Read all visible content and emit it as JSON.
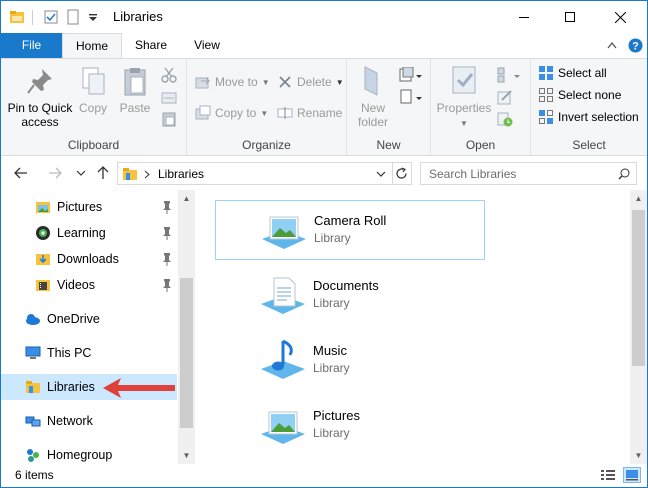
{
  "window": {
    "title": "Libraries",
    "controls": {
      "minimize": "—",
      "maximize": "☐",
      "close": "✕"
    }
  },
  "tabs": [
    {
      "label": "File"
    },
    {
      "label": "Home"
    },
    {
      "label": "Share"
    },
    {
      "label": "View"
    }
  ],
  "ribbon": {
    "clipboard": {
      "label": "Clipboard",
      "pin_line1": "Pin to Quick",
      "pin_line2": "access",
      "copy": "Copy",
      "paste": "Paste"
    },
    "organize": {
      "label": "Organize",
      "move_to": "Move to",
      "copy_to": "Copy to",
      "delete": "Delete",
      "rename": "Rename"
    },
    "new": {
      "label": "New",
      "new_line1": "New",
      "new_line2": "folder"
    },
    "open": {
      "label": "Open",
      "properties": "Properties"
    },
    "select": {
      "label": "Select",
      "select_all": "Select all",
      "select_none": "Select none",
      "invert": "Invert selection"
    }
  },
  "address": {
    "path": "Libraries",
    "search_placeholder": "Search Libraries"
  },
  "nav": {
    "items": [
      {
        "label": "Pictures",
        "icon": "pictures-icon",
        "pinned": true
      },
      {
        "label": "Learning",
        "icon": "learning-icon",
        "pinned": true
      },
      {
        "label": "Downloads",
        "icon": "downloads-icon",
        "pinned": true
      },
      {
        "label": "Videos",
        "icon": "videos-icon",
        "pinned": true
      },
      {
        "label": "OneDrive",
        "icon": "onedrive-icon"
      },
      {
        "label": "This PC",
        "icon": "this-pc-icon"
      },
      {
        "label": "Libraries",
        "icon": "libraries-icon",
        "selected": true
      },
      {
        "label": "Network",
        "icon": "network-icon"
      },
      {
        "label": "Homegroup",
        "icon": "homegroup-icon"
      }
    ]
  },
  "content": {
    "items": [
      {
        "name": "Camera Roll",
        "type": "Library",
        "icon": "camera-roll-library-icon",
        "selected": true
      },
      {
        "name": "Documents",
        "type": "Library",
        "icon": "documents-library-icon"
      },
      {
        "name": "Music",
        "type": "Library",
        "icon": "music-library-icon"
      },
      {
        "name": "Pictures",
        "type": "Library",
        "icon": "pictures-library-icon"
      }
    ]
  },
  "status": {
    "count": "6 items"
  },
  "colors": {
    "accent": "#1979ca",
    "selection": "#cce8ff",
    "arrow": "#e0403a"
  }
}
